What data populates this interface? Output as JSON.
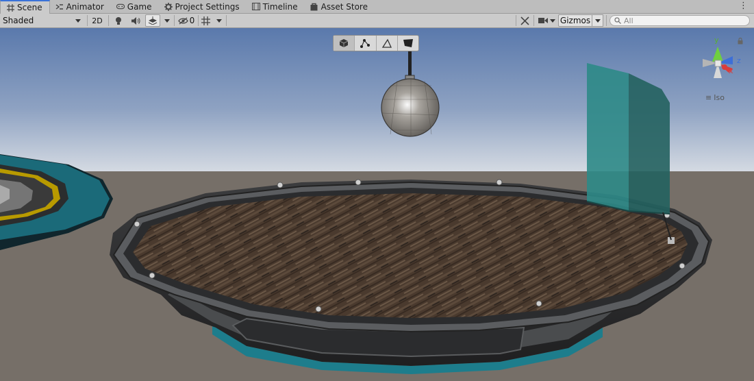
{
  "tabs": [
    {
      "label": "Scene",
      "icon": "grid-icon",
      "active": true
    },
    {
      "label": "Animator",
      "icon": "animator-icon"
    },
    {
      "label": "Game",
      "icon": "gamepad-icon"
    },
    {
      "label": "Project Settings",
      "icon": "gear-icon"
    },
    {
      "label": "Timeline",
      "icon": "timeline-icon"
    },
    {
      "label": "Asset Store",
      "icon": "bag-icon"
    }
  ],
  "toolbar": {
    "shading_mode": "Shaded",
    "mode_2d": "2D",
    "hidden_count": "0",
    "gizmos": "Gizmos",
    "search_placeholder": "All"
  },
  "gizmo": {
    "y": "y",
    "z": "z",
    "x": "x",
    "projection": "Iso"
  },
  "colors": {
    "sky_top": "#5a79ac",
    "sky_horizon": "#d3dae2",
    "ground": "#766f68",
    "accent_tab": "#3a72d8",
    "glass": "#2e8a87",
    "teal_trim": "#1f8896",
    "gold_ring": "#d4b000"
  }
}
